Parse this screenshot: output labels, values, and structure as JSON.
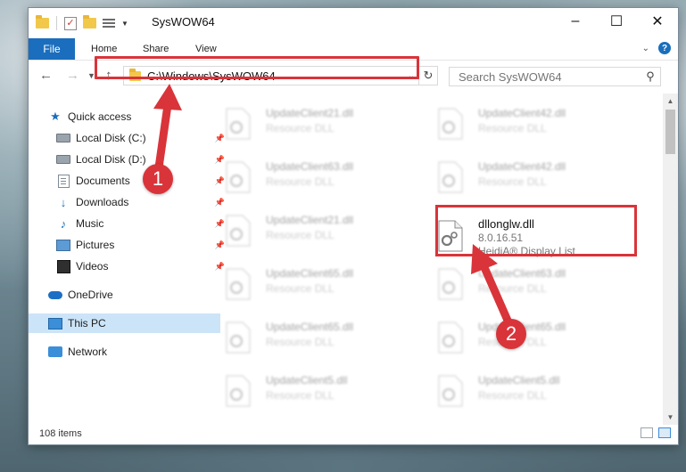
{
  "window": {
    "title": "SysWOW64"
  },
  "ribbon": {
    "tabs": [
      "File",
      "Home",
      "Share",
      "View"
    ]
  },
  "address": {
    "path": "C:\\Windows\\SysWOW64"
  },
  "search": {
    "placeholder": "Search SysWOW64"
  },
  "sidebar": {
    "items": [
      {
        "label": "Quick access",
        "icon": "star-icon"
      },
      {
        "label": "Local Disk (C:)",
        "icon": "drive-icon",
        "pinned": true
      },
      {
        "label": "Local Disk (D:)",
        "icon": "drive-icon",
        "pinned": true
      },
      {
        "label": "Documents",
        "icon": "documents-icon",
        "pinned": true
      },
      {
        "label": "Downloads",
        "icon": "download-icon",
        "pinned": true
      },
      {
        "label": "Music",
        "icon": "music-icon",
        "pinned": true
      },
      {
        "label": "Pictures",
        "icon": "pictures-icon",
        "pinned": true
      },
      {
        "label": "Videos",
        "icon": "videos-icon",
        "pinned": true
      },
      {
        "label": "OneDrive",
        "icon": "cloud-icon"
      },
      {
        "label": "This PC",
        "icon": "computer-icon",
        "selected": true
      },
      {
        "label": "Network",
        "icon": "network-icon"
      }
    ]
  },
  "files": {
    "left": [
      {
        "name": "UpdateClient21.dll",
        "desc": "Resource DLL"
      },
      {
        "name": "UpdateClient63.dll",
        "desc": "Resource DLL"
      },
      {
        "name": "UpdateClient21.dll",
        "desc": "Resource DLL"
      },
      {
        "name": "UpdateClient65.dll",
        "desc": "Resource DLL"
      },
      {
        "name": "UpdateClient65.dll",
        "desc": "Resource DLL"
      },
      {
        "name": "UpdateClient5.dll",
        "desc": "Resource DLL"
      }
    ],
    "right": [
      {
        "name": "UpdateClient42.dll",
        "desc": "Resource DLL"
      },
      {
        "name": "UpdateClient42.dll",
        "desc": "Resource DLL"
      },
      {
        "name": "dllonglw.dll",
        "version": "8.0.16.51",
        "desc": "HeidiA® Display List",
        "highlighted": true
      },
      {
        "name": "UpdateClient63.dll",
        "desc": "Resource DLL"
      },
      {
        "name": "UpdateClient65.dll",
        "desc": "Resource DLL"
      },
      {
        "name": "UpdateClient5.dll",
        "desc": "Resource DLL"
      }
    ]
  },
  "status": {
    "item_count": "108 items"
  },
  "annotations": {
    "step1": "1",
    "step2": "2",
    "color": "#d9343a"
  }
}
